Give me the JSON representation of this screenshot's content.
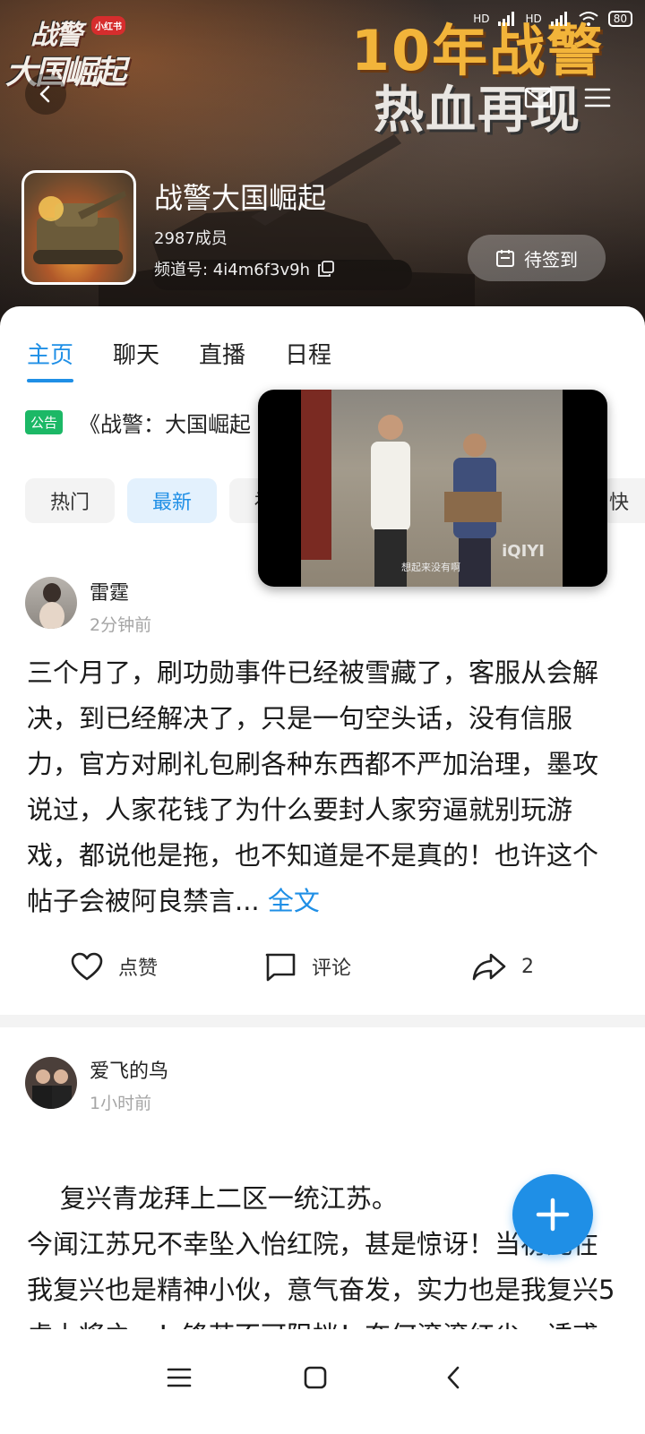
{
  "status_bar": {
    "signal1": "HD",
    "signal2": "HD",
    "battery": "80"
  },
  "banner": {
    "logo_line1": "战警",
    "logo_line2": "大国崛起",
    "logo_tag": "小红书",
    "promo_line1": "10年战警",
    "promo_line2": "热血再现"
  },
  "group": {
    "name": "战警大国崛起",
    "members": "2987成员",
    "channel": "频道号: 4i4m6f3v9h",
    "checkin_label": "待签到"
  },
  "tabs": [
    {
      "label": "主页",
      "active": true
    },
    {
      "label": "聊天",
      "active": false
    },
    {
      "label": "直播",
      "active": false
    },
    {
      "label": "日程",
      "active": false
    }
  ],
  "notice": {
    "badge": "公告",
    "text": "《战警：大国崛起"
  },
  "filters": [
    {
      "label": "热门",
      "active": false
    },
    {
      "label": "最新",
      "active": true
    },
    {
      "label": "福利",
      "active": false
    }
  ],
  "filter_overflow": "快",
  "video": {
    "watermark": "iQIYI",
    "subtitle": "想起来没有啊"
  },
  "posts": [
    {
      "author": "雷霆",
      "time": "2分钟前",
      "body": "三个月了，刷功勋事件已经被雪藏了，客服从会解决，到已经解决了，只是一句空头话，没有信服力，官方对刷礼包刷各种东西都不严加治理，墨攻说过，人家花钱了为什么要封人家穷逼就别玩游戏，都说他是拖，也不知道是不是真的！也许这个帖子会被阿良禁言...",
      "more": "全文",
      "like_label": "点赞",
      "comment_label": "评论",
      "share_count": "2"
    },
    {
      "author": "爱飞的鸟",
      "time": "1小时前",
      "body": "复兴青龙拜上二区一统江苏。\n今闻江苏兄不幸坠入怡红院，甚是惊讶！当初兄在我复兴也是精神小伙，意气奋发，实力也是我复兴5虎上将之一！锋芒不可阻挡！奈何滚滚红尘，诱惑太多，不幸被聚义老贼勾搭"
    }
  ],
  "icons": {
    "back": "chevron-left-icon",
    "mail": "mail-icon",
    "menu": "menu-icon",
    "copy": "copy-icon",
    "calendar": "calendar-icon",
    "like": "heart-icon",
    "comment": "comment-icon",
    "share": "share-icon",
    "add": "plus-icon"
  },
  "colors": {
    "accent": "#1f8fe6",
    "notice_badge": "#1cb866",
    "promo_gold": "#f2b43a"
  }
}
